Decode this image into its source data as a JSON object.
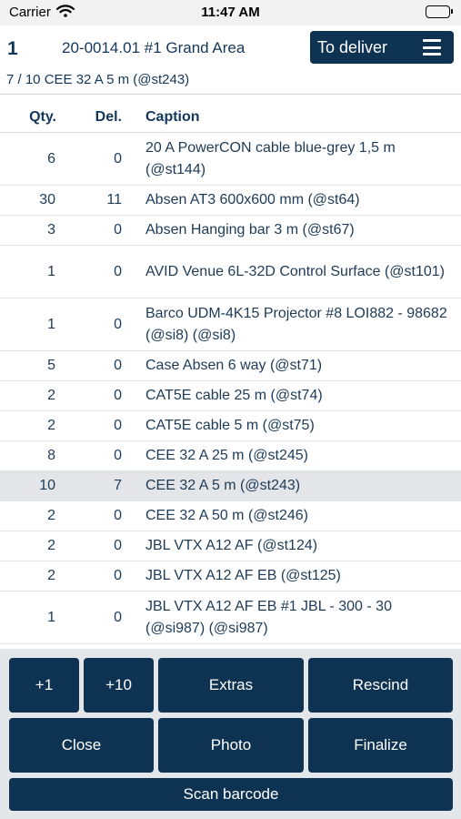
{
  "status_bar": {
    "carrier": "Carrier",
    "time": "11:47 AM"
  },
  "header": {
    "index": "1",
    "title": "20-0014.01 #1 Grand Area",
    "subtitle": "7 / 10 CEE 32 A 5 m (@st243)",
    "status_button_label": "To deliver",
    "status_button_icon": "menu-icon"
  },
  "table": {
    "headers": {
      "qty": "Qty.",
      "del": "Del.",
      "caption": "Caption"
    },
    "rows": [
      {
        "qty": "6",
        "del": "0",
        "caption": "20 A PowerCON cable blue-grey 1,5 m (@st144)"
      },
      {
        "qty": "30",
        "del": "11",
        "caption": "Absen AT3 600x600 mm (@st64)"
      },
      {
        "qty": "3",
        "del": "0",
        "caption": "Absen Hanging bar 3 m (@st67)"
      },
      {
        "qty": "1",
        "del": "0",
        "caption": "AVID Venue 6L-32D Control Surface (@st101)"
      },
      {
        "qty": "1",
        "del": "0",
        "caption": "Barco UDM-4K15 Projector #8 LOI882 - 98682 (@si8) (@si8)"
      },
      {
        "qty": "5",
        "del": "0",
        "caption": "Case Absen 6 way (@st71)"
      },
      {
        "qty": "2",
        "del": "0",
        "caption": "CAT5E cable 25 m (@st74)"
      },
      {
        "qty": "2",
        "del": "0",
        "caption": "CAT5E cable 5 m (@st75)"
      },
      {
        "qty": "8",
        "del": "0",
        "caption": "CEE 32 A 25 m (@st245)"
      },
      {
        "qty": "10",
        "del": "7",
        "caption": "CEE 32 A 5 m (@st243)"
      },
      {
        "qty": "2",
        "del": "0",
        "caption": "CEE 32 A 50 m (@st246)"
      },
      {
        "qty": "2",
        "del": "0",
        "caption": "JBL VTX A12 AF (@st124)"
      },
      {
        "qty": "2",
        "del": "0",
        "caption": "JBL VTX A12 AF EB (@st125)"
      },
      {
        "qty": "1",
        "del": "0",
        "caption": "JBL VTX A12 AF EB #1 JBL - 300 - 30 (@si987) (@si987)"
      }
    ]
  },
  "buttons": {
    "plus1": "+1",
    "plus10": "+10",
    "extras": "Extras",
    "rescind": "Rescind",
    "close": "Close",
    "photo": "Photo",
    "finalize": "Finalize",
    "scan": "Scan barcode"
  },
  "colors": {
    "primary": "#0e3251",
    "selected_row": "#e3e5e8",
    "footer_bg": "#e4e7ea"
  }
}
